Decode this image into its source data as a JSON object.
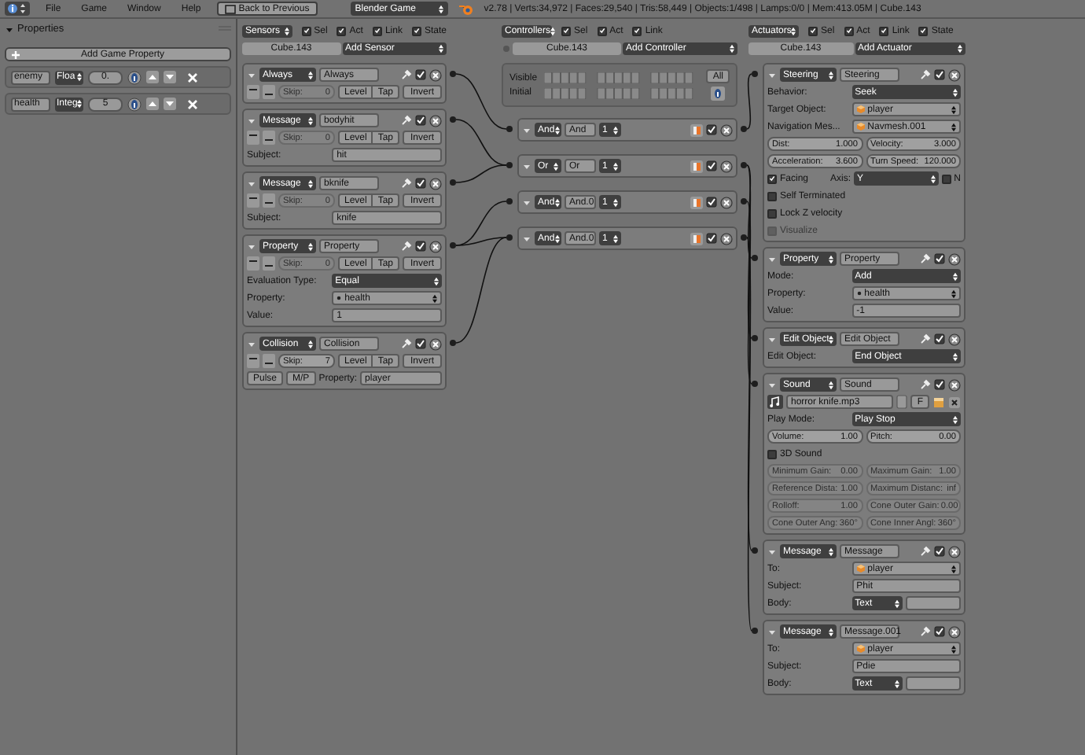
{
  "header": {
    "menus": [
      "File",
      "Game",
      "Window",
      "Help"
    ],
    "back_button": "Back to Previous",
    "engine": "Blender Game",
    "stats": "v2.78 | Verts:34,972 | Faces:29,540 | Tris:58,449 | Objects:1/498 | Lamps:0/0 | Mem:413.05M | Cube.143"
  },
  "properties": {
    "title": "Properties",
    "add_button": "Add Game Property",
    "items": [
      {
        "name": "enemy",
        "type": "Floa",
        "value": "0."
      },
      {
        "name": "health",
        "type": "Integ",
        "value": "5"
      }
    ]
  },
  "sensors": {
    "menu": "Sensors",
    "filters": [
      {
        "label": "Sel",
        "checked": true
      },
      {
        "label": "Act",
        "checked": true
      },
      {
        "label": "Link",
        "checked": true
      },
      {
        "label": "State",
        "checked": true
      }
    ],
    "object": "Cube.143",
    "add_button": "Add Sensor",
    "items": [
      {
        "type": "Always",
        "name": "Always",
        "active": true,
        "skip": {
          "label": "Skip:",
          "value": "0",
          "disabled": true
        },
        "level": "Level",
        "tap": "Tap",
        "invert": "Invert"
      },
      {
        "type": "Message",
        "name": "bodyhit",
        "active": true,
        "skip": {
          "label": "Skip:",
          "value": "0",
          "disabled": true
        },
        "level": "Level",
        "tap": "Tap",
        "invert": "Invert",
        "rows": [
          {
            "cells": [
              {
                "kind": "label",
                "text": "Subject:"
              },
              {
                "kind": "text",
                "value": "hit"
              }
            ]
          }
        ]
      },
      {
        "type": "Message",
        "name": "bknife",
        "active": true,
        "skip": {
          "label": "Skip:",
          "value": "0",
          "disabled": true
        },
        "level": "Level",
        "tap": "Tap",
        "invert": "Invert",
        "rows": [
          {
            "cells": [
              {
                "kind": "label",
                "text": "Subject:"
              },
              {
                "kind": "text",
                "value": "knife"
              }
            ]
          }
        ]
      },
      {
        "type": "Property",
        "name": "Property",
        "active": true,
        "skip": {
          "label": "Skip:",
          "value": "0",
          "disabled": true
        },
        "level": "Level",
        "tap": "Tap",
        "invert": "Invert",
        "rows": [
          {
            "cells": [
              {
                "kind": "label",
                "text": "Evaluation Type:"
              },
              {
                "kind": "dropdown",
                "value": "Equal"
              }
            ]
          },
          {
            "cells": [
              {
                "kind": "label",
                "text": "Property:"
              },
              {
                "kind": "search",
                "value": "health"
              }
            ]
          },
          {
            "cells": [
              {
                "kind": "label",
                "text": "Value:"
              },
              {
                "kind": "text",
                "value": "1"
              }
            ]
          }
        ]
      },
      {
        "type": "Collision",
        "name": "Collision",
        "active": true,
        "skip": {
          "label": "Skip:",
          "value": "7",
          "disabled": false
        },
        "level": "Level",
        "tap": "Tap",
        "invert": "Invert",
        "rows": [
          {
            "cells": [
              {
                "kind": "button",
                "label": "Pulse"
              },
              {
                "kind": "button",
                "label": "M/P"
              },
              {
                "kind": "label",
                "text": "Property:"
              },
              {
                "kind": "text",
                "value": "player"
              }
            ]
          }
        ]
      }
    ]
  },
  "controllers": {
    "menu": "Controllers",
    "filters": [
      {
        "label": "Sel",
        "checked": true
      },
      {
        "label": "Act",
        "checked": true
      },
      {
        "label": "Link",
        "checked": true
      }
    ],
    "object": "Cube.143",
    "add_button": "Add Controller",
    "layers": {
      "visible_label": "Visible",
      "initial_label": "Initial",
      "all_button": "All"
    },
    "items": [
      {
        "type": "And",
        "name": "And",
        "state": "1",
        "active": true
      },
      {
        "type": "Or",
        "name": "Or",
        "state": "1",
        "active": true
      },
      {
        "type": "And",
        "name": "And.0",
        "state": "1",
        "active": true
      },
      {
        "type": "And",
        "name": "And.0",
        "state": "1",
        "active": true
      }
    ]
  },
  "actuators": {
    "menu": "Actuators",
    "filters": [
      {
        "label": "Sel",
        "checked": true
      },
      {
        "label": "Act",
        "checked": true
      },
      {
        "label": "Link",
        "checked": true
      },
      {
        "label": "State",
        "checked": true
      }
    ],
    "object": "Cube.143",
    "add_button": "Add Actuator",
    "items": [
      {
        "type": "Steering",
        "name": "Steering",
        "active": true,
        "rows": [
          {
            "cells": [
              {
                "kind": "label",
                "text": "Behavior:"
              },
              {
                "kind": "dropdown",
                "value": "Seek"
              }
            ]
          },
          {
            "cells": [
              {
                "kind": "label",
                "text": "Target Object:"
              },
              {
                "kind": "object",
                "value": "player"
              }
            ]
          },
          {
            "cells": [
              {
                "kind": "label",
                "text": "Navigation Mes..."
              },
              {
                "kind": "object",
                "value": "Navmesh.001"
              }
            ]
          },
          {
            "cells": [
              {
                "kind": "number",
                "label": "Dist:",
                "value": "1.000",
                "disabled": false
              },
              {
                "kind": "number",
                "label": "Velocity:",
                "value": "3.000",
                "disabled": false
              }
            ]
          },
          {
            "cells": [
              {
                "kind": "number",
                "label": "Acceleration:",
                "value": "3.600",
                "disabled": false
              },
              {
                "kind": "number",
                "label": "Turn Speed:",
                "value": "120.000",
                "disabled": false
              }
            ]
          },
          {
            "facing": {
              "label": "Facing",
              "checked": true
            },
            "axis_label": "Axis:",
            "axis": "Y",
            "normal": {
              "label": "N",
              "checked": false
            }
          },
          {
            "cells": [
              {
                "kind": "check",
                "label": "Self Terminated",
                "checked": false,
                "disabled": false
              }
            ]
          },
          {
            "cells": [
              {
                "kind": "check",
                "label": "Lock Z velocity",
                "checked": false,
                "disabled": false
              }
            ]
          },
          {
            "cells": [
              {
                "kind": "check",
                "label": "Visualize",
                "checked": false,
                "disabled": true
              }
            ]
          }
        ]
      },
      {
        "type": "Property",
        "name": "Property",
        "active": true,
        "rows": [
          {
            "cells": [
              {
                "kind": "label",
                "text": "Mode:"
              },
              {
                "kind": "dropdown",
                "value": "Add"
              }
            ]
          },
          {
            "cells": [
              {
                "kind": "label",
                "text": "Property:"
              },
              {
                "kind": "search",
                "value": "health"
              }
            ]
          },
          {
            "cells": [
              {
                "kind": "label",
                "text": "Value:"
              },
              {
                "kind": "text",
                "value": "-1"
              }
            ]
          }
        ]
      },
      {
        "type": "Edit Object",
        "name": "Edit Object",
        "active": true,
        "rows": [
          {
            "cells": [
              {
                "kind": "label",
                "text": "Edit Object:"
              },
              {
                "kind": "dropdown",
                "value": "End Object"
              }
            ]
          }
        ]
      },
      {
        "type": "Sound",
        "name": "Sound",
        "active": true,
        "rows": [
          {
            "cells": [
              {
                "kind": "file",
                "value": "horror knife.mp3"
              },
              {
                "kind": "button",
                "label": "F"
              },
              {
                "kind": "pack"
              }
            ]
          },
          {
            "cells": [
              {
                "kind": "label",
                "text": "Play Mode:"
              },
              {
                "kind": "dropdown",
                "value": "Play Stop"
              }
            ]
          },
          {
            "cells": [
              {
                "kind": "number",
                "label": "Volume:",
                "value": "1.00",
                "disabled": false
              },
              {
                "kind": "number",
                "label": "Pitch:",
                "value": "0.00",
                "disabled": false
              }
            ]
          },
          {
            "cells": [
              {
                "kind": "check",
                "label": "3D Sound",
                "checked": false,
                "disabled": false
              }
            ]
          },
          {
            "cells": [
              {
                "kind": "number",
                "label": "Minimum Gain:",
                "value": "0.00",
                "disabled": true
              },
              {
                "kind": "number",
                "label": "Maximum Gain:",
                "value": "1.00",
                "disabled": true
              }
            ]
          },
          {
            "cells": [
              {
                "kind": "number",
                "label": "Reference Dista:",
                "value": "1.00",
                "disabled": true
              },
              {
                "kind": "number",
                "label": "Maximum Distanc:",
                "value": "inf",
                "disabled": true
              }
            ]
          },
          {
            "cells": [
              {
                "kind": "number",
                "label": "Rolloff:",
                "value": "1.00",
                "disabled": true
              },
              {
                "kind": "number",
                "label": "Cone Outer Gain:",
                "value": "0.00",
                "disabled": true
              }
            ]
          },
          {
            "cells": [
              {
                "kind": "number",
                "label": "Cone Outer Ang:",
                "value": "360°",
                "disabled": true
              },
              {
                "kind": "number",
                "label": "Cone Inner Angl:",
                "value": "360°",
                "disabled": true
              }
            ]
          }
        ]
      },
      {
        "type": "Message",
        "name": "Message",
        "active": true,
        "rows": [
          {
            "cells": [
              {
                "kind": "label",
                "text": "To:"
              },
              {
                "kind": "object",
                "value": "player"
              }
            ]
          },
          {
            "cells": [
              {
                "kind": "label",
                "text": "Subject:"
              },
              {
                "kind": "text",
                "value": "Phit"
              }
            ]
          },
          {
            "cells": [
              {
                "kind": "label",
                "text": "Body:"
              },
              {
                "kind": "dropdown",
                "value": "Text"
              },
              {
                "kind": "blank"
              }
            ]
          }
        ]
      },
      {
        "type": "Message",
        "name": "Message.001",
        "active": true,
        "rows": [
          {
            "cells": [
              {
                "kind": "label",
                "text": "To:"
              },
              {
                "kind": "object",
                "value": "player"
              }
            ]
          },
          {
            "cells": [
              {
                "kind": "label",
                "text": "Subject:"
              },
              {
                "kind": "text",
                "value": "Pdie"
              }
            ]
          },
          {
            "cells": [
              {
                "kind": "label",
                "text": "Body:"
              },
              {
                "kind": "dropdown",
                "value": "Text"
              },
              {
                "kind": "blank"
              }
            ]
          }
        ]
      }
    ]
  }
}
